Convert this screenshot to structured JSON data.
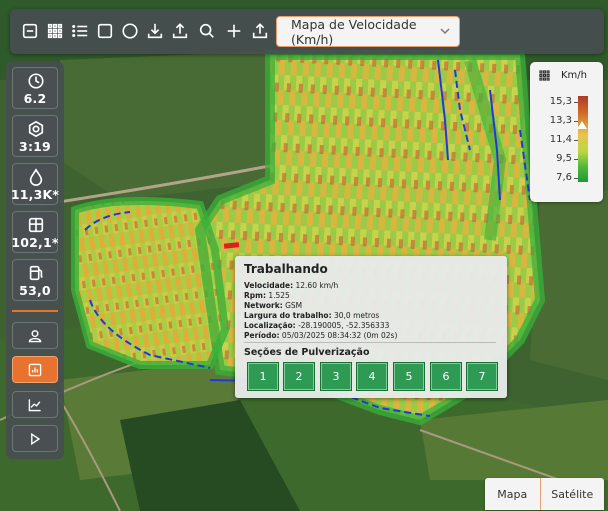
{
  "toolbar": {
    "icons": [
      "minus-square-icon",
      "grid-icon",
      "list-icon",
      "square-icon",
      "circle-icon",
      "download-icon",
      "upload-icon",
      "search-icon",
      "plus-icon",
      "export-icon"
    ],
    "map_select_value": "Mapa de Velocidade (Km/h)"
  },
  "stats": [
    {
      "icon": "clock-icon",
      "value": "6.2"
    },
    {
      "icon": "settings-icon",
      "value": "3:19"
    },
    {
      "icon": "drop-icon",
      "value": "11,3K*"
    },
    {
      "icon": "area-icon",
      "value": "102,1*"
    },
    {
      "icon": "fuel-icon",
      "value": "53,0"
    }
  ],
  "side_buttons": [
    "user-icon",
    "report-icon",
    "line-chart-icon",
    "play-icon"
  ],
  "legend": {
    "unit": "Km/h",
    "values": [
      "15,3",
      "13,3",
      "11,4",
      "9,5",
      "7,6"
    ]
  },
  "popup": {
    "title": "Trabalhando",
    "rows": [
      {
        "label": "Velocidade:",
        "value": "12.60 km/h"
      },
      {
        "label": "Rpm:",
        "value": "1.525"
      },
      {
        "label": "Network:",
        "value": "GSM"
      },
      {
        "label": "Largura do trabalho:",
        "value": "30,0 metros"
      },
      {
        "label": "Localização:",
        "value": "-28.190005, -52.356333"
      },
      {
        "label": "Período:",
        "value": "05/03/2025 08:34:32 (0m 02s)"
      }
    ],
    "sections_title": "Seções de Pulverização",
    "sections": [
      "1",
      "2",
      "3",
      "4",
      "5",
      "6",
      "7"
    ]
  },
  "map_type": {
    "options": [
      "Mapa",
      "Satélite"
    ],
    "selected": "Mapa"
  },
  "colors": {
    "accent": "#e8732e",
    "panel": "#464e50",
    "section_green": "#2e9a54"
  }
}
